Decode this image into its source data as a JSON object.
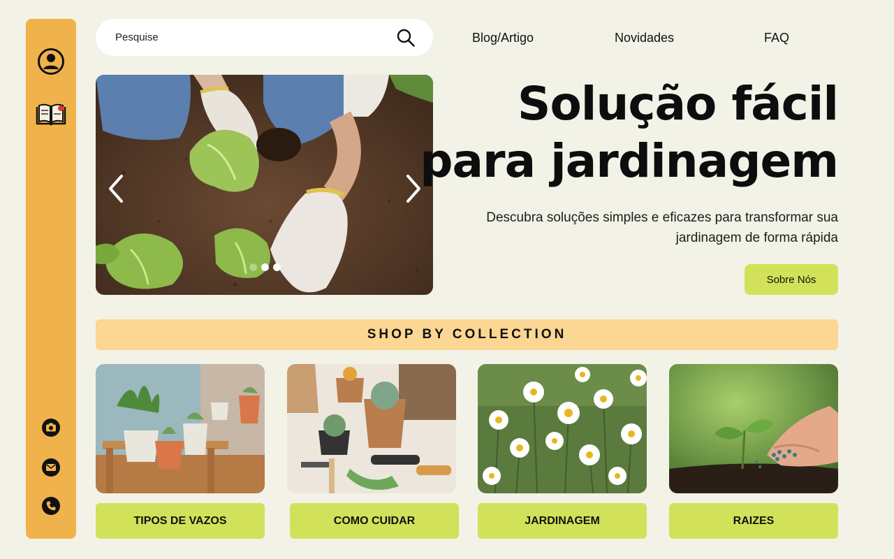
{
  "search": {
    "placeholder": "Pesquise"
  },
  "nav": {
    "blog": "Blog/Artigo",
    "news": "Novidades",
    "faq": "FAQ"
  },
  "hero": {
    "title_line1": "Solução fácil",
    "title_line2": "para jardinagem",
    "subtitle_line1": "Descubra soluções simples e eficazes para transformar sua",
    "subtitle_line2": "jardinagem de forma rápida",
    "button": "Sobre Nós"
  },
  "carousel": {
    "slides": 3,
    "active": 2
  },
  "collection": {
    "title": "SHOP BY COLLECTION",
    "cards": [
      {
        "label": "TIPOS DE VAZOS"
      },
      {
        "label": "COMO CUIDAR"
      },
      {
        "label": "JARDINAGEM"
      },
      {
        "label": "RAIZES"
      }
    ]
  },
  "sidebar": {
    "icons": [
      "user-icon",
      "book-icon",
      "camera-icon",
      "mail-icon",
      "phone-icon"
    ]
  },
  "colors": {
    "background": "#f3f2e7",
    "sidebar": "#f0b24a",
    "accent_green": "#d2e15a",
    "collection_bar": "#fcd793"
  }
}
